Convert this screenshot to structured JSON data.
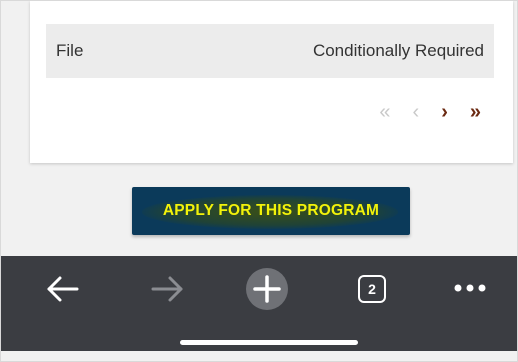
{
  "table": {
    "row": {
      "file_label": "File",
      "requirement": "Conditionally Required"
    }
  },
  "pagination": {
    "first": "«",
    "prev": "‹",
    "next": "›",
    "last": "»"
  },
  "actions": {
    "apply_label": "APPLY FOR THIS PROGRAM"
  },
  "browser_bar": {
    "tab_count": "2",
    "icons": [
      "back-arrow-icon",
      "forward-arrow-icon",
      "new-tab-plus-icon",
      "tab-switcher-icon",
      "more-menu-icon"
    ]
  },
  "colors": {
    "button_bg": "#0b3a5a",
    "button_text": "#f2f20a",
    "pager_active": "#6b2a12",
    "bar_bg": "#3b3d42"
  }
}
